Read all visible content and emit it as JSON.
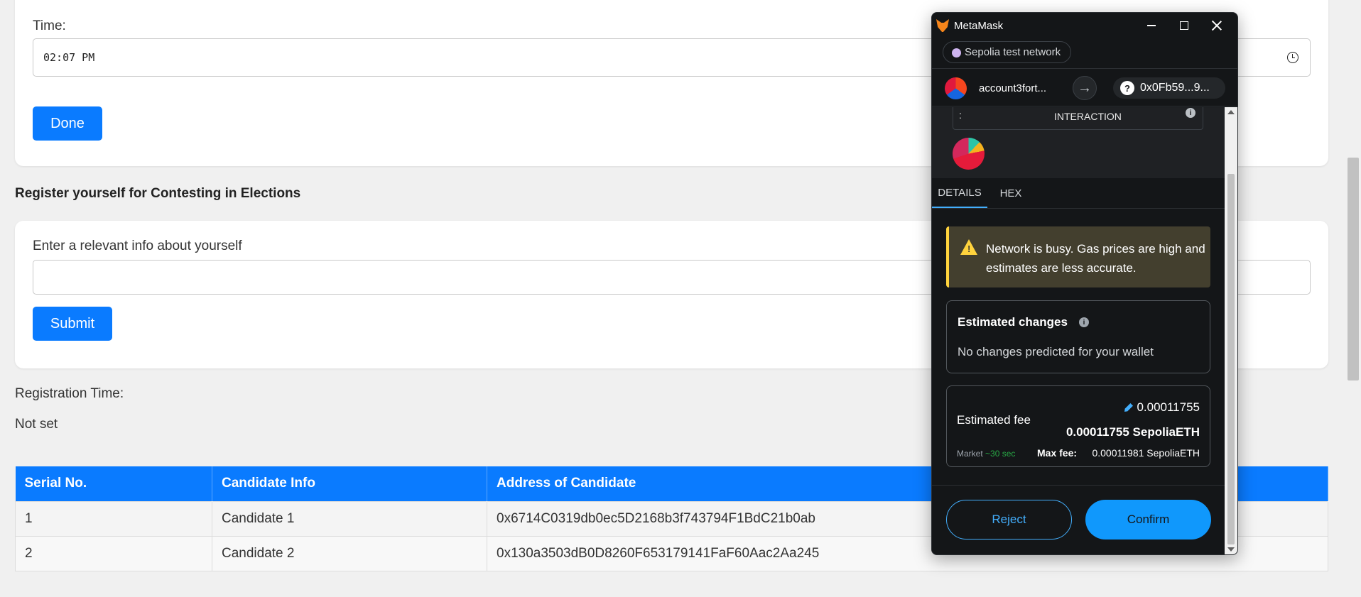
{
  "time_section": {
    "label": "Time:",
    "value": "02:07 PM",
    "done_label": "Done"
  },
  "register_section": {
    "heading": "Register yourself for Contesting in Elections",
    "input_label": "Enter a relevant info about yourself",
    "input_value": "",
    "submit_label": "Submit"
  },
  "registration_time": {
    "label": "Registration Time:",
    "value": "Not set"
  },
  "candidates_table": {
    "headers": [
      "Serial No.",
      "Candidate Info",
      "Address of Candidate"
    ],
    "rows": [
      [
        "1",
        "Candidate 1",
        "0x6714C0319db0ec5D2168b3f743794F1BdC21b0ab"
      ],
      [
        "2",
        "Candidate 2",
        "0x130a3503dB0D8260F653179141FaF60Aac2Aa245"
      ]
    ]
  },
  "metamask": {
    "window_title": "MetaMask",
    "network": "Sepolia test network",
    "account_name": "account3fort...",
    "to_address": "0x0Fb59...9...",
    "origin_right": "INTERACTION",
    "origin_left": ":",
    "tabs": [
      "DETAILS",
      "HEX"
    ],
    "warning": "Network is busy. Gas prices are high and estimates are less accurate.",
    "estimated_changes": {
      "title": "Estimated changes",
      "body": "No changes predicted for your wallet"
    },
    "fee": {
      "label": "Estimated fee",
      "value": "0.00011755",
      "value_eth": "0.00011755 SepoliaETH",
      "market": "Market",
      "market_time": "~30 sec",
      "max_fee_label": "Max fee:",
      "max_fee_value": "0.00011981 SepoliaETH"
    },
    "reject_label": "Reject",
    "confirm_label": "Confirm"
  },
  "colors": {
    "primary_blue": "#0a7bff",
    "metamask_bg": "#141618",
    "metamask_accent": "#43aefc",
    "warning_yellow": "#ffd33d"
  }
}
